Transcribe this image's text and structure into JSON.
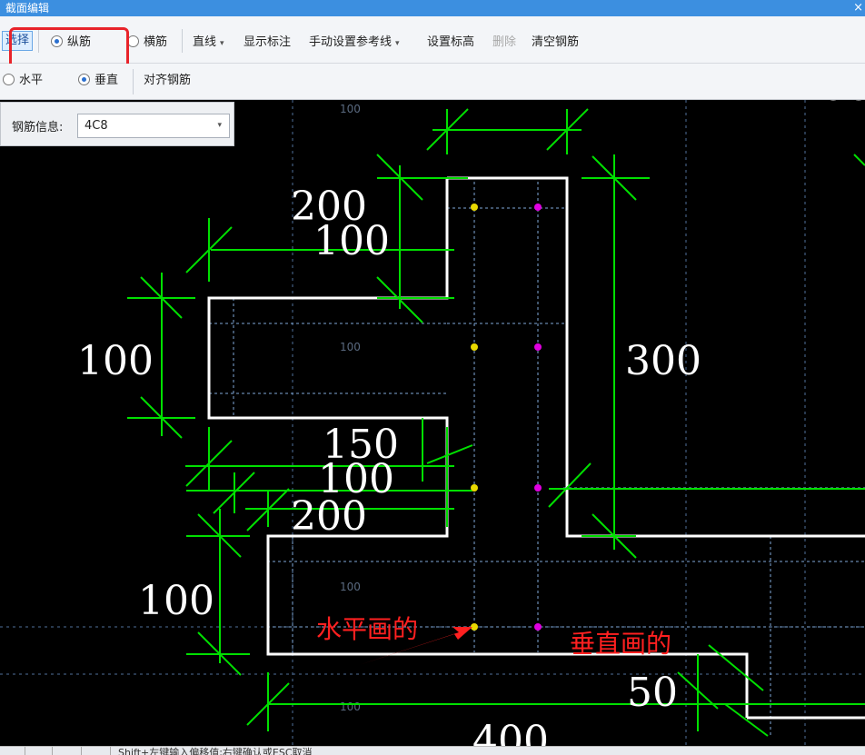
{
  "window": {
    "title": "截面编辑",
    "close_glyph": "×"
  },
  "toolbar": {
    "select": "选择",
    "longitudinal": "纵筋",
    "transverse": "横筋",
    "line": "直线",
    "show_dims": "显示标注",
    "manual_ref": "手动设置参考线",
    "set_elev": "设置标高",
    "delete": "删除",
    "clear": "清空钢筋"
  },
  "toolbar2": {
    "horizontal": "水平",
    "vertical": "垂直",
    "align": "对齐钢筋"
  },
  "info": {
    "label": "钢筋信息:",
    "value": "4C8"
  },
  "dims": {
    "d200a": "200",
    "d100a": "100",
    "d100left": "100",
    "d300": "300",
    "d150": "150",
    "d100b": "100",
    "d200b": "200",
    "d100c": "100",
    "d50": "50",
    "d400": "400",
    "d100top": "100"
  },
  "grid_labels": [
    "100",
    "100",
    "100",
    "100"
  ],
  "annotations": {
    "horizontal_drawn": "水平画的",
    "vertical_drawn": "垂直画的"
  },
  "colors": {
    "dimension": "#00e000",
    "outline": "#ffffff",
    "rebar_h": "#e8d800",
    "rebar_v": "#e000e0",
    "annotation": "#ff2020",
    "grid": "#5a7fb0"
  },
  "status": {
    "text": "Shift+左键输入偏移值;右键确认或ESC取消"
  }
}
